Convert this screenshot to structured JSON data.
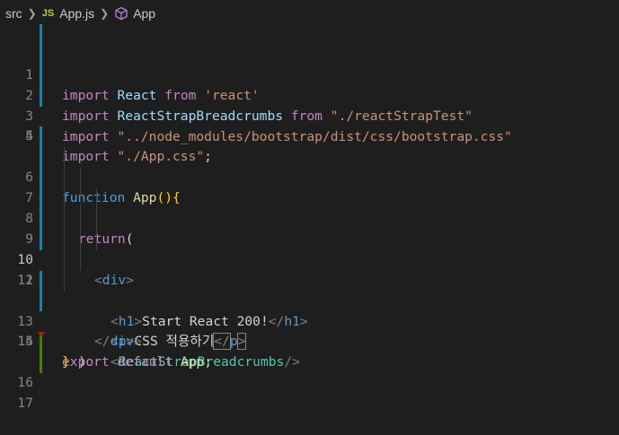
{
  "breadcrumb": {
    "folder": "src",
    "file_badge": "JS",
    "file": "App.js",
    "symbol": "App"
  },
  "lines": [
    {
      "num": "1",
      "tokens": [
        "import",
        "React",
        "from",
        "'react'"
      ]
    },
    {
      "num": "2",
      "tokens": [
        "import",
        "ReactStrapBreadcrumbs",
        "from",
        "\"./reactStrapTest\""
      ]
    },
    {
      "num": "3",
      "tokens": [
        "import",
        "\"../node_modules/bootstrap/dist/css/bootstrap.css\""
      ]
    },
    {
      "num": "4",
      "tokens": [
        "import",
        "\"./App.css\"",
        ";"
      ]
    },
    {
      "num": "5",
      "tokens": []
    },
    {
      "num": "6",
      "tokens": [
        "function",
        "App",
        "(){"
      ]
    },
    {
      "num": "7",
      "tokens": [
        "return",
        "("
      ]
    },
    {
      "num": "8",
      "tokens": [
        "<",
        "div",
        ">"
      ]
    },
    {
      "num": "9",
      "tokens": [
        "<",
        "h1",
        ">",
        "Start React 200!",
        "</",
        "h1",
        ">"
      ]
    },
    {
      "num": "10",
      "tokens": [
        "<",
        "p",
        ">",
        "CSS 적용하기",
        "</",
        "p",
        ">"
      ]
    },
    {
      "num": "11",
      "tokens": [
        "<",
        "ReactStrapBreadcrumbs",
        "/>"
      ]
    },
    {
      "num": "12",
      "tokens": [
        "</",
        "div",
        ">"
      ]
    },
    {
      "num": "13",
      "tokens": [
        ")"
      ]
    },
    {
      "num": "14",
      "tokens": [
        "}"
      ]
    },
    {
      "num": "15",
      "tokens": [
        "export",
        "default",
        "App",
        ";"
      ]
    },
    {
      "num": "16",
      "tokens": []
    },
    {
      "num": "17",
      "tokens": []
    }
  ]
}
